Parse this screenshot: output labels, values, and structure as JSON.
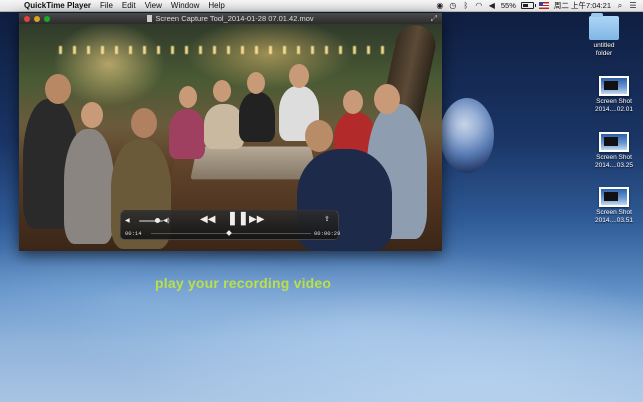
{
  "menubar": {
    "app_name": "QuickTime Player",
    "menus": [
      "File",
      "Edit",
      "View",
      "Window",
      "Help"
    ],
    "battery_text": "55%",
    "clock": "周二 上午7:04:21"
  },
  "window": {
    "title": "Screen Capture Tool_2014-01-28 07.01.42.mov"
  },
  "player": {
    "elapsed": "00:14",
    "remaining": "00:00:29"
  },
  "overlay": {
    "caption": "play your recording video"
  },
  "desktop": {
    "icons": [
      {
        "label_line1": "untitled",
        "label_line2": "folder",
        "icon": "folder-icon"
      },
      {
        "label_line1": "Screen Shot",
        "label_line2": "2014....02.01",
        "icon": "screenshot-icon"
      },
      {
        "label_line1": "Screen Shot",
        "label_line2": "2014....03.25",
        "icon": "screenshot-icon"
      },
      {
        "label_line1": "Screen Shot",
        "label_line2": "2014....03.51",
        "icon": "screenshot-icon"
      }
    ]
  },
  "colors": {
    "caption": "#b9e04a",
    "close": "#e0443e",
    "minimize": "#dea123",
    "zoom": "#1aab29"
  }
}
